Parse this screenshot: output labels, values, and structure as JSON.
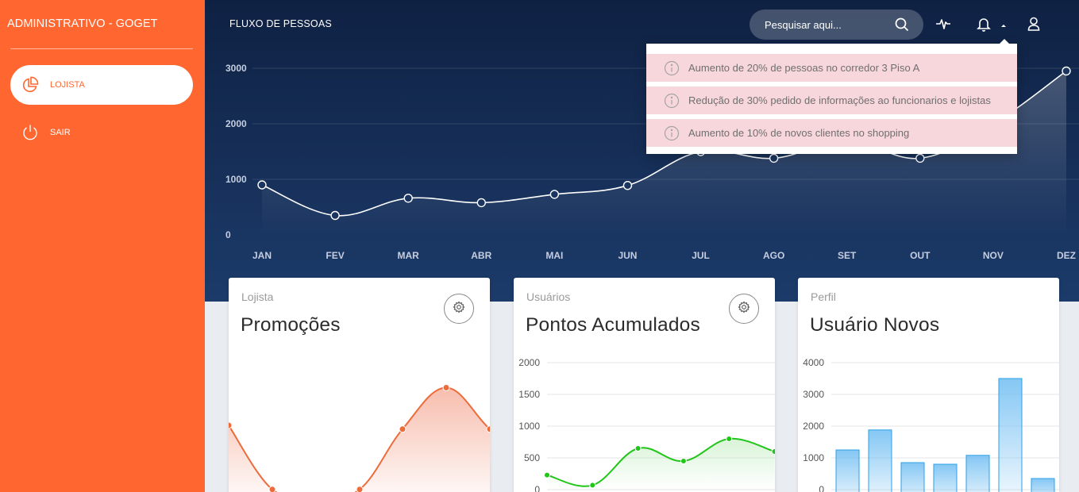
{
  "sidebar": {
    "brand": "ADMINISTRATIVO - GOGET",
    "items": [
      {
        "label": "LOJISTA",
        "icon": "pie-chart-icon",
        "active": true
      },
      {
        "label": "SAIR",
        "icon": "power-icon",
        "active": false
      }
    ]
  },
  "header": {
    "title": "FLUXO DE PESSOAS",
    "search_placeholder": "Pesquisar aqui...",
    "icons": [
      "search-icon",
      "activity-pulse-icon",
      "bell-icon",
      "caret-up-icon",
      "user-icon"
    ]
  },
  "notifications": [
    "Aumento de 20% de pessoas no corredor 3 Piso A",
    "Redução de 30% pedido de informações ao funcionarios e lojistas",
    "Aumento de 10% de novos clientes no shopping"
  ],
  "colors": {
    "sidebar": "#ff6630",
    "panel_top": "#0f2143",
    "panel_bottom": "#1c3b6a",
    "notification_bg": "#f8d7dc",
    "orange_line": "#ec6c3c",
    "green_line": "#22c51a",
    "blue_bar": "#2ca0e8"
  },
  "cards": [
    {
      "category": "Lojista",
      "title": "Promoções",
      "has_settings": true
    },
    {
      "category": "Usuários",
      "title": "Pontos Acumulados",
      "has_settings": true
    },
    {
      "category": "Perfil",
      "title": "Usuário Novos",
      "has_settings": false
    }
  ],
  "chart_data": [
    {
      "type": "line",
      "x": [
        "JAN",
        "FEV",
        "MAR",
        "ABR",
        "MAI",
        "JUN",
        "JUL",
        "AGO",
        "SET",
        "OUT",
        "NOV",
        "DEZ"
      ],
      "values": [
        900,
        350,
        660,
        580,
        730,
        890,
        1500,
        1380,
        1700,
        1380,
        2000,
        2950
      ],
      "yticks": [
        0,
        1000,
        2000,
        3000
      ],
      "ylim": [
        0,
        3000
      ],
      "grid": true
    },
    {
      "type": "line",
      "values": [
        1200,
        350,
        260,
        350,
        1150,
        1700,
        1150,
        750
      ],
      "area": true
    },
    {
      "type": "line",
      "values": [
        230,
        70,
        650,
        450,
        800,
        600
      ],
      "yticks": [
        0,
        500,
        1000,
        1500,
        2000
      ],
      "ylim": [
        0,
        2000
      ],
      "area": true,
      "grid": true
    },
    {
      "type": "bar",
      "values": [
        1250,
        1880,
        850,
        800,
        1080,
        3500,
        350
      ],
      "yticks": [
        0,
        1000,
        2000,
        3000,
        4000
      ],
      "ylim": [
        0,
        4000
      ],
      "grid": true
    }
  ]
}
